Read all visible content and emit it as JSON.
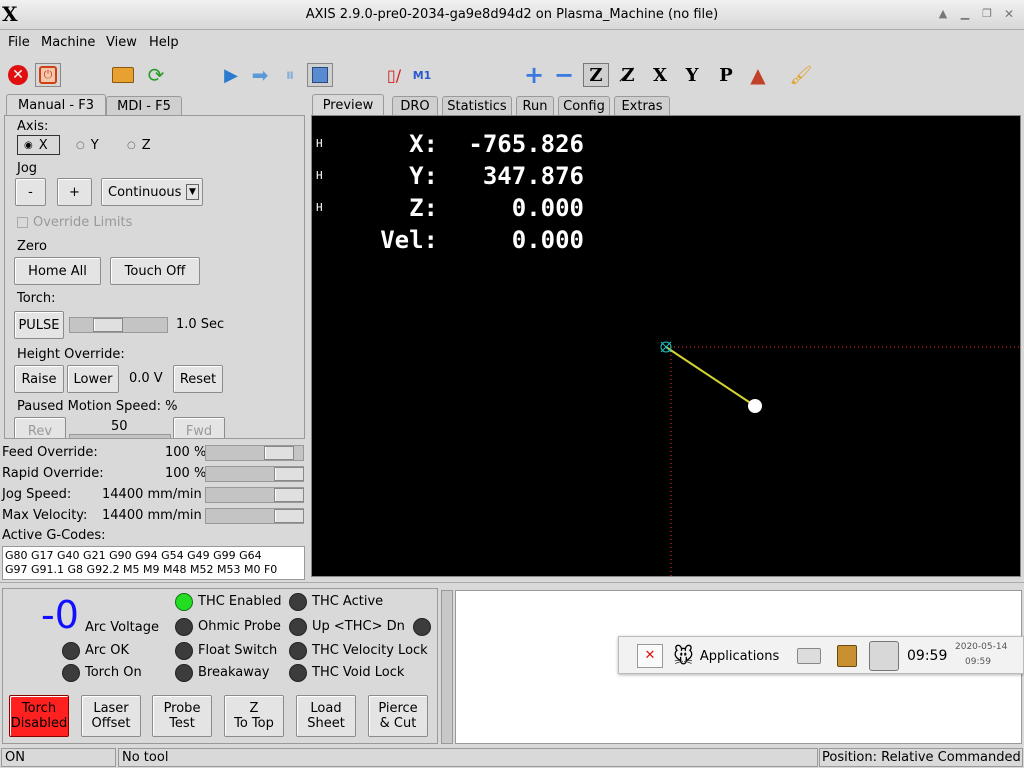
{
  "window": {
    "title": "AXIS 2.9.0-pre0-2034-ga9e8d94d2 on Plasma_Machine (no file)"
  },
  "menu": [
    "File",
    "Machine",
    "View",
    "Help"
  ],
  "left_tabs": [
    "Manual - F3",
    "MDI - F5"
  ],
  "right_tabs": [
    "Preview",
    "DRO",
    "Statistics",
    "Run",
    "Config",
    "Extras"
  ],
  "manual": {
    "axis_label": "Axis:",
    "axes": [
      "X",
      "Y",
      "Z"
    ],
    "selected_axis": "X",
    "jog_label": "Jog",
    "jog_minus": "-",
    "jog_plus": "+",
    "jog_mode": "Continuous",
    "override_limits": "Override Limits",
    "zero_label": "Zero",
    "home_all": "Home All",
    "touch_off": "Touch Off",
    "torch_label": "Torch:",
    "pulse": "PULSE",
    "pulse_value": "1.0 Sec",
    "height_override_label": "Height Override:",
    "raise": "Raise",
    "lower": "Lower",
    "height_value": "0.0 V",
    "reset": "Reset",
    "paused_speed_label": "Paused Motion Speed: %",
    "rev": "Rev",
    "paused_speed_value": "50",
    "fwd": "Fwd"
  },
  "overrides": [
    {
      "label": "Feed Override:",
      "value": "100 %",
      "level": 1.0
    },
    {
      "label": "Rapid Override:",
      "value": "100 %",
      "level": 1.0
    },
    {
      "label": "Jog Speed:",
      "value": "14400 mm/min",
      "level": 1.0
    },
    {
      "label": "Max Velocity:",
      "value": "14400 mm/min",
      "level": 1.0
    }
  ],
  "gcodes": {
    "label": "Active G-Codes:",
    "line1": "G80 G17 G40 G21 G90 G94 G54 G49 G99 G64",
    "line2": "G97 G91.1 G8 G92.2 M5 M9 M48 M52 M53 M0 F0"
  },
  "dro": [
    {
      "home": "H",
      "label": "X:",
      "value": "-765.826"
    },
    {
      "home": "H",
      "label": "Y:",
      "value": "347.876"
    },
    {
      "home": "H",
      "label": "Z:",
      "value": "0.000"
    },
    {
      "label": "Vel:",
      "value": "0.000"
    }
  ],
  "plasma": {
    "arc_voltage": "-0",
    "arc_voltage_label": "Arc Voltage",
    "leds_left": [
      {
        "label": "Arc OK",
        "on": false
      },
      {
        "label": "Torch On",
        "on": false
      }
    ],
    "leds_mid": [
      {
        "label": "THC Enabled",
        "on": true
      },
      {
        "label": "Ohmic Probe",
        "on": false
      },
      {
        "label": "Float Switch",
        "on": false
      },
      {
        "label": "Breakaway",
        "on": false
      }
    ],
    "leds_right": [
      {
        "label": "THC Active",
        "on": false
      },
      {
        "label": "Up <THC> Dn",
        "on": false
      },
      {
        "label": "THC Velocity Lock",
        "on": false
      },
      {
        "label": "THC Void Lock",
        "on": false
      }
    ],
    "buttons": [
      {
        "line1": "Torch",
        "line2": "Disabled"
      },
      {
        "line1": "Laser",
        "line2": "Offset"
      },
      {
        "line1": "Probe",
        "line2": "Test"
      },
      {
        "line1": "Z",
        "line2": "To Top"
      },
      {
        "line1": "Load",
        "line2": "Sheet"
      },
      {
        "line1": "Pierce",
        "line2": "& Cut"
      }
    ]
  },
  "taskbar": {
    "applications": "Applications",
    "clock": "09:59",
    "date": "2020-05-14",
    "time_small": "09:59"
  },
  "status": {
    "state": "ON",
    "tool": "No tool",
    "position": "Position: Relative Commanded"
  },
  "colors": {
    "led_on": "#22dd22",
    "torch_disabled": "#ff2020",
    "preview_bg": "#000000",
    "arc_voltage": "#1010ff"
  }
}
